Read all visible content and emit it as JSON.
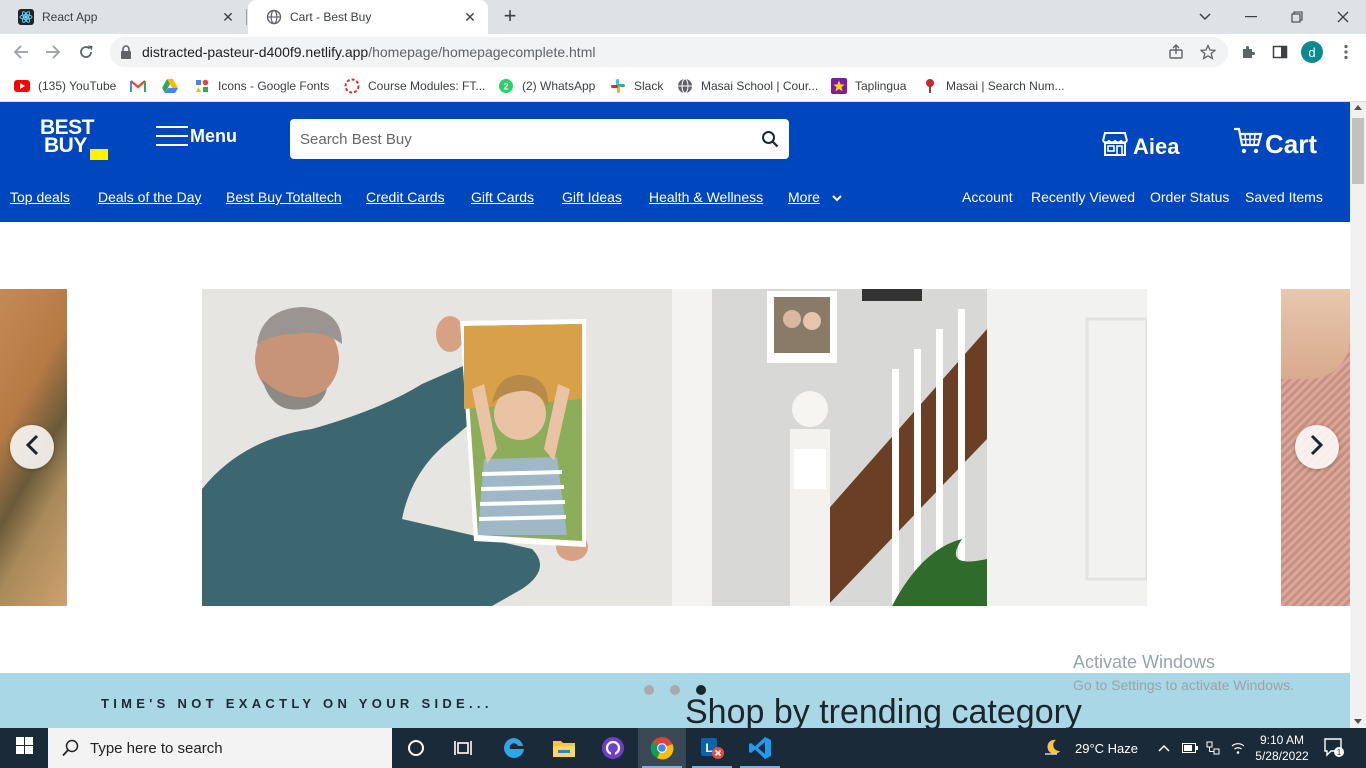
{
  "browser": {
    "tabs": [
      {
        "title": "React App",
        "favicon": "react-icon",
        "active": false
      },
      {
        "title": "Cart - Best Buy",
        "favicon": "globe-icon",
        "active": true
      }
    ],
    "url_domain": "distracted-pasteur-d400f9.netlify.app",
    "url_path": "/homepage/homepagecomplete.html",
    "profile_initial": "d",
    "bookmarks": [
      {
        "label": "(135) YouTube",
        "icon": "youtube-icon"
      },
      {
        "label": "",
        "icon": "gmail-icon"
      },
      {
        "label": "",
        "icon": "google-drive-icon"
      },
      {
        "label": "Icons - Google Fonts",
        "icon": "google-fonts-icon"
      },
      {
        "label": "Course Modules: FT...",
        "icon": "course-icon"
      },
      {
        "label": "(2) WhatsApp",
        "icon": "whatsapp-icon"
      },
      {
        "label": "Slack",
        "icon": "slack-icon"
      },
      {
        "label": "Masai School | Cour...",
        "icon": "globe-icon"
      },
      {
        "label": "Taplingua",
        "icon": "taplingua-icon"
      },
      {
        "label": "Masai | Search Num...",
        "icon": "masai-icon"
      }
    ]
  },
  "header": {
    "logo_line1": "BEST",
    "logo_line2": "BUY",
    "menu_label": "Menu",
    "search_placeholder": "Search Best Buy",
    "store_label": "Aiea",
    "cart_label": "Cart",
    "nav_links": [
      "Top deals",
      "Deals of the Day",
      "Best Buy Totaltech",
      "Credit Cards",
      "Gift Cards",
      "Gift Ideas",
      "Health & Wellness"
    ],
    "more_label": "More",
    "right_links": [
      "Account",
      "Recently Viewed",
      "Order Status",
      "Saved Items"
    ],
    "brand_color": "#0046be",
    "accent_color": "#fff200"
  },
  "carousel": {
    "slide_count": 3,
    "active_index": 2
  },
  "content": {
    "promo_text": "TIME'S NOT EXACTLY ON YOUR SIDE...",
    "section_title": "Shop by trending category"
  },
  "watermark": {
    "line1": "Activate Windows",
    "line2": "Go to Settings to activate Windows."
  },
  "taskbar": {
    "search_placeholder": "Type here to search",
    "weather": "29°C  Haze",
    "time": "9:10 AM",
    "date": "5/28/2022",
    "notification_count": "1",
    "apps": [
      "cortana-icon",
      "task-view-icon",
      "edge-icon",
      "file-explorer-icon",
      "github-desktop-icon",
      "chrome-icon",
      "outlook-icon",
      "vscode-icon"
    ]
  }
}
